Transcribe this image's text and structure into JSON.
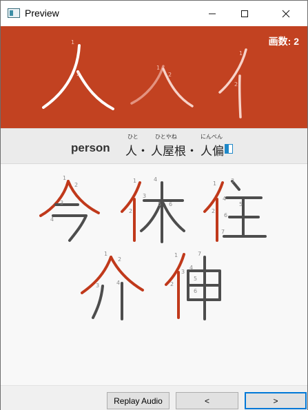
{
  "window": {
    "title": "Preview"
  },
  "banner": {
    "stroke_count": "画数: 2"
  },
  "meaning": {
    "word": "person",
    "readings": [
      {
        "kanji": "人・",
        "ruby": "ひと"
      },
      {
        "kanji": "人屋根・",
        "ruby": "ひとやね"
      },
      {
        "kanji": "人偏",
        "ruby": "にんべん"
      }
    ]
  },
  "examples": [
    "今",
    "休",
    "住",
    "介",
    "伸"
  ],
  "buttons": {
    "replay": "Replay Audio",
    "prev": "<",
    "next": ">"
  },
  "colors": {
    "banner": "#c24221",
    "accent_stroke": "#c0391b",
    "dark_stroke": "#4d4d4d",
    "focus": "#0078d7"
  }
}
